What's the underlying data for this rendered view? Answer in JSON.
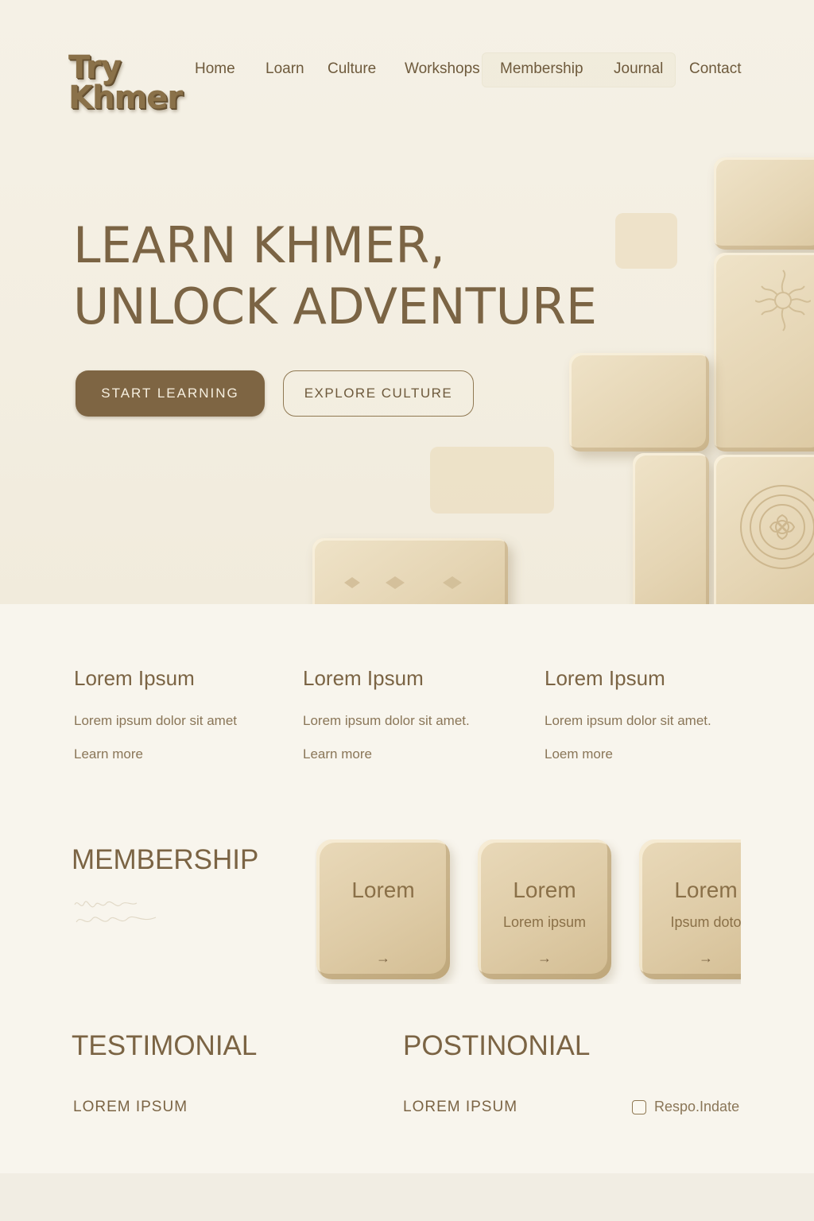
{
  "brand": {
    "line1": "Try",
    "line2": "Khmer"
  },
  "nav": {
    "items": [
      "Home",
      "Loarn",
      "Culture",
      "Workshops",
      "Membership",
      "Journal",
      "Contact"
    ],
    "active": "Membership"
  },
  "hero": {
    "title_line1": "LEARN KHMER,",
    "title_line2": "UNLOCK ADVENTURE",
    "primary_button": "START LEARNING",
    "secondary_button": "EXPLORE CULTURE"
  },
  "features": [
    {
      "title": "Lorem Ipsum",
      "text": "Lorem ipsum dolor sit amet",
      "link": "Learn more"
    },
    {
      "title": "Lorem Ipsum",
      "text": "Lorem ipsum dolor sit amet.",
      "link": "Learn more"
    },
    {
      "title": "Lorem Ipsum",
      "text": "Lorem ipsum dolor sit amet.",
      "link": "Loem more"
    }
  ],
  "membership": {
    "title": "MEMBERSHIP",
    "cards": [
      {
        "title": "Lorem",
        "subtitle": "",
        "arrow": "→"
      },
      {
        "title": "Lorem",
        "subtitle": "Lorem ipsum",
        "arrow": "→"
      },
      {
        "title": "Lorem",
        "subtitle": "Ipsum doto",
        "arrow": "→"
      }
    ]
  },
  "testimonials": {
    "left_title": "TESTIMONIAL",
    "left_label": "LOREM IPSUM",
    "right_title": "POSTINONIAL",
    "right_label": "LOREM IPSUM",
    "checkbox_label": "Respo.Indate"
  },
  "colors": {
    "background": "#f8f5ed",
    "accent": "#7e6543",
    "text": "#7b6444",
    "tile": "#e5d5b4"
  },
  "icons": {
    "card_arrow": "arrow-right-icon",
    "tile_motif": "khmer-flower-motif-icon"
  }
}
